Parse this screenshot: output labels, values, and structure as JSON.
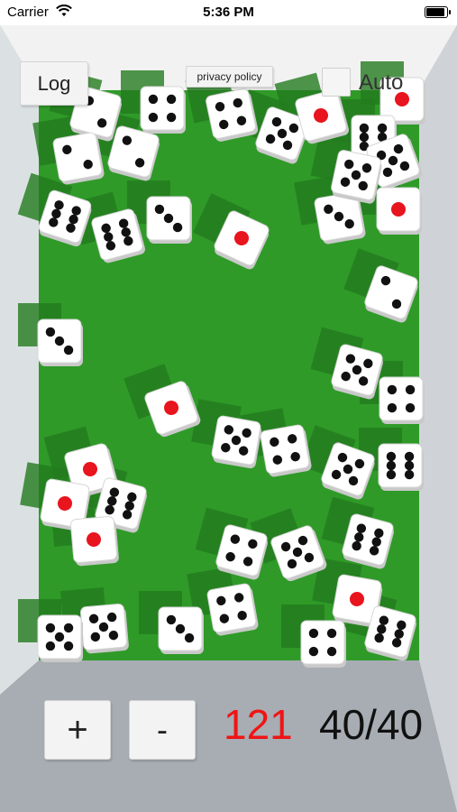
{
  "status_bar": {
    "carrier": "Carrier",
    "time": "5:36 PM"
  },
  "controls": {
    "log_label": "Log",
    "privacy_label": "privacy policy",
    "auto_label": "Auto",
    "auto_checked": false,
    "plus_label": "+",
    "minus_label": "-"
  },
  "result": {
    "sum": "121",
    "count": "40/40"
  },
  "colors": {
    "table_felt": "#2f9a28",
    "sum_text": "#f01414",
    "pip": "#111111",
    "one_pip": "#e8141e"
  },
  "dice": [
    2,
    4,
    4,
    5,
    1,
    1,
    2,
    2,
    6,
    5,
    6,
    6,
    3,
    1,
    3,
    1,
    5,
    2,
    3,
    1,
    5,
    4,
    5,
    4,
    5,
    6,
    1,
    1,
    6,
    1,
    4,
    5,
    6,
    1,
    4,
    6,
    5,
    3,
    5,
    4
  ]
}
